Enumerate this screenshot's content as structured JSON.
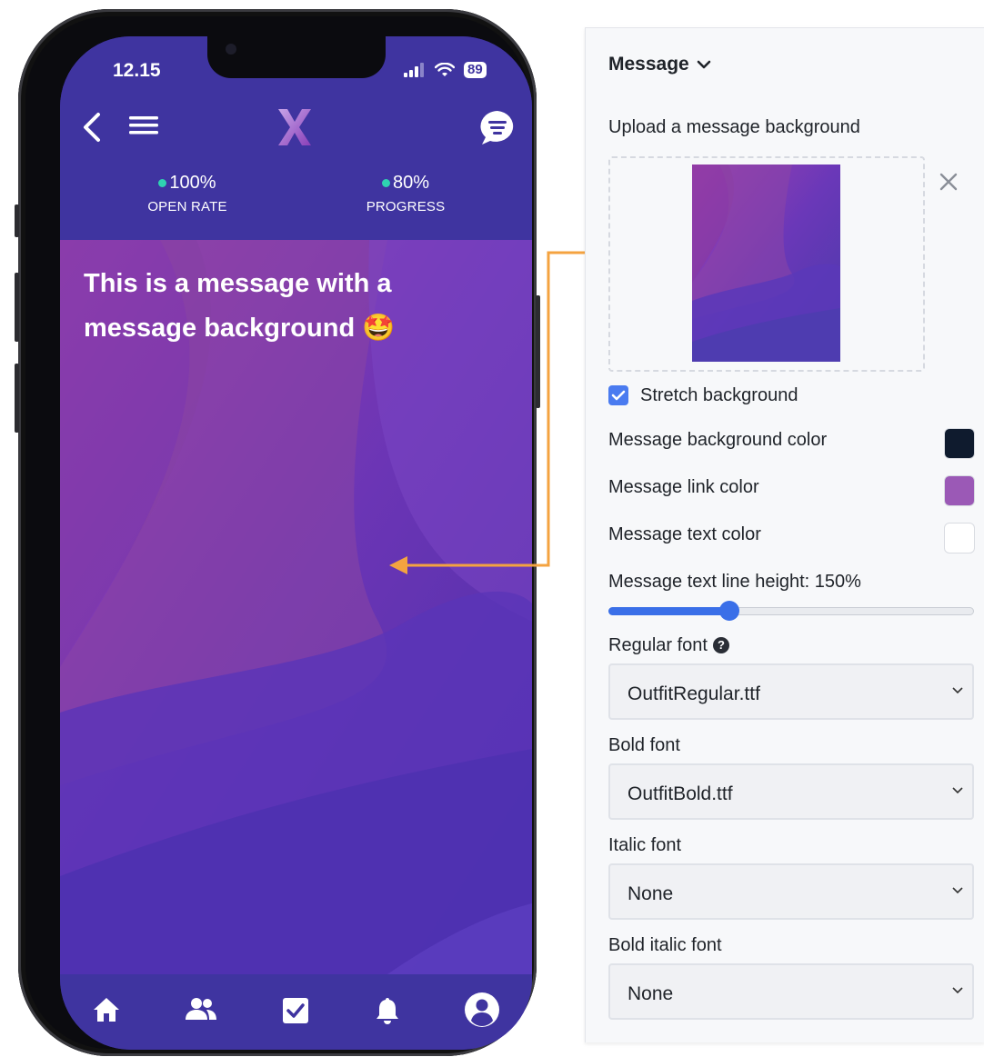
{
  "phone": {
    "status": {
      "time": "12.15",
      "battery": "89"
    },
    "stats": [
      {
        "value": "100%",
        "label": "OPEN RATE"
      },
      {
        "value": "80%",
        "label": "PROGRESS"
      }
    ],
    "message": "This is a message with a message background 🤩",
    "tabbar": [
      "home-icon",
      "people-icon",
      "checkbox-icon",
      "bell-icon",
      "profile-icon"
    ],
    "colors": {
      "header": "#3f34a0",
      "accent_dot": "#2fd3b1"
    }
  },
  "panel": {
    "section_title": "Message",
    "upload_label": "Upload a message background",
    "stretch_label": "Stretch background",
    "stretch_checked": true,
    "bg_color_label": "Message background color",
    "bg_color": "#0f1b2e",
    "link_color_label": "Message link color",
    "link_color": "#9b59b6",
    "text_color_label": "Message text color",
    "text_color": "#ffffff",
    "line_height_label": "Message text line height: 150%",
    "line_height_value": 0.33,
    "regular_font_label": "Regular font",
    "regular_font_value": "OutfitRegular.ttf",
    "bold_font_label": "Bold font",
    "bold_font_value": "OutfitBold.ttf",
    "italic_font_label": "Italic font",
    "italic_font_value": "None",
    "bold_italic_font_label": "Bold italic font",
    "bold_italic_font_value": "None"
  }
}
